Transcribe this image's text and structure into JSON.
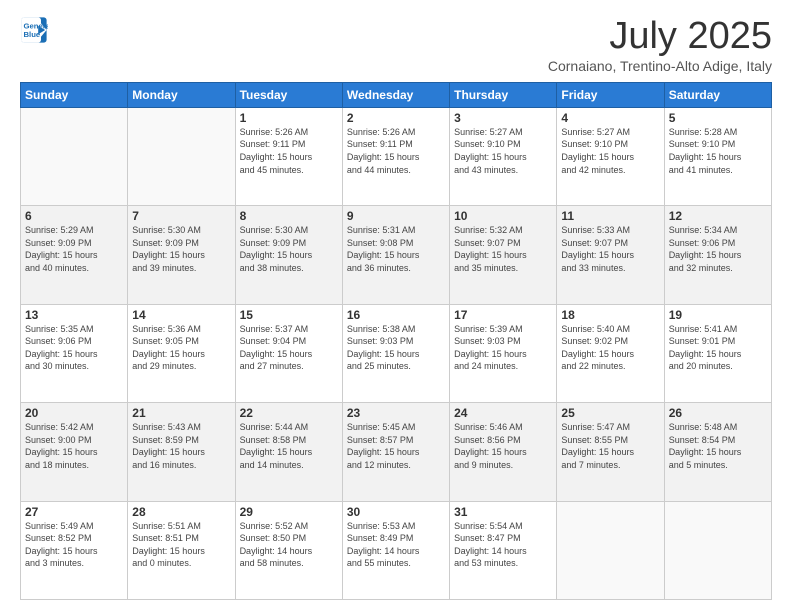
{
  "logo": {
    "line1": "General",
    "line2": "Blue"
  },
  "title": "July 2025",
  "subtitle": "Cornaiano, Trentino-Alto Adige, Italy",
  "weekdays": [
    "Sunday",
    "Monday",
    "Tuesday",
    "Wednesday",
    "Thursday",
    "Friday",
    "Saturday"
  ],
  "weeks": [
    [
      {
        "day": "",
        "info": ""
      },
      {
        "day": "",
        "info": ""
      },
      {
        "day": "1",
        "info": "Sunrise: 5:26 AM\nSunset: 9:11 PM\nDaylight: 15 hours\nand 45 minutes."
      },
      {
        "day": "2",
        "info": "Sunrise: 5:26 AM\nSunset: 9:11 PM\nDaylight: 15 hours\nand 44 minutes."
      },
      {
        "day": "3",
        "info": "Sunrise: 5:27 AM\nSunset: 9:10 PM\nDaylight: 15 hours\nand 43 minutes."
      },
      {
        "day": "4",
        "info": "Sunrise: 5:27 AM\nSunset: 9:10 PM\nDaylight: 15 hours\nand 42 minutes."
      },
      {
        "day": "5",
        "info": "Sunrise: 5:28 AM\nSunset: 9:10 PM\nDaylight: 15 hours\nand 41 minutes."
      }
    ],
    [
      {
        "day": "6",
        "info": "Sunrise: 5:29 AM\nSunset: 9:09 PM\nDaylight: 15 hours\nand 40 minutes."
      },
      {
        "day": "7",
        "info": "Sunrise: 5:30 AM\nSunset: 9:09 PM\nDaylight: 15 hours\nand 39 minutes."
      },
      {
        "day": "8",
        "info": "Sunrise: 5:30 AM\nSunset: 9:09 PM\nDaylight: 15 hours\nand 38 minutes."
      },
      {
        "day": "9",
        "info": "Sunrise: 5:31 AM\nSunset: 9:08 PM\nDaylight: 15 hours\nand 36 minutes."
      },
      {
        "day": "10",
        "info": "Sunrise: 5:32 AM\nSunset: 9:07 PM\nDaylight: 15 hours\nand 35 minutes."
      },
      {
        "day": "11",
        "info": "Sunrise: 5:33 AM\nSunset: 9:07 PM\nDaylight: 15 hours\nand 33 minutes."
      },
      {
        "day": "12",
        "info": "Sunrise: 5:34 AM\nSunset: 9:06 PM\nDaylight: 15 hours\nand 32 minutes."
      }
    ],
    [
      {
        "day": "13",
        "info": "Sunrise: 5:35 AM\nSunset: 9:06 PM\nDaylight: 15 hours\nand 30 minutes."
      },
      {
        "day": "14",
        "info": "Sunrise: 5:36 AM\nSunset: 9:05 PM\nDaylight: 15 hours\nand 29 minutes."
      },
      {
        "day": "15",
        "info": "Sunrise: 5:37 AM\nSunset: 9:04 PM\nDaylight: 15 hours\nand 27 minutes."
      },
      {
        "day": "16",
        "info": "Sunrise: 5:38 AM\nSunset: 9:03 PM\nDaylight: 15 hours\nand 25 minutes."
      },
      {
        "day": "17",
        "info": "Sunrise: 5:39 AM\nSunset: 9:03 PM\nDaylight: 15 hours\nand 24 minutes."
      },
      {
        "day": "18",
        "info": "Sunrise: 5:40 AM\nSunset: 9:02 PM\nDaylight: 15 hours\nand 22 minutes."
      },
      {
        "day": "19",
        "info": "Sunrise: 5:41 AM\nSunset: 9:01 PM\nDaylight: 15 hours\nand 20 minutes."
      }
    ],
    [
      {
        "day": "20",
        "info": "Sunrise: 5:42 AM\nSunset: 9:00 PM\nDaylight: 15 hours\nand 18 minutes."
      },
      {
        "day": "21",
        "info": "Sunrise: 5:43 AM\nSunset: 8:59 PM\nDaylight: 15 hours\nand 16 minutes."
      },
      {
        "day": "22",
        "info": "Sunrise: 5:44 AM\nSunset: 8:58 PM\nDaylight: 15 hours\nand 14 minutes."
      },
      {
        "day": "23",
        "info": "Sunrise: 5:45 AM\nSunset: 8:57 PM\nDaylight: 15 hours\nand 12 minutes."
      },
      {
        "day": "24",
        "info": "Sunrise: 5:46 AM\nSunset: 8:56 PM\nDaylight: 15 hours\nand 9 minutes."
      },
      {
        "day": "25",
        "info": "Sunrise: 5:47 AM\nSunset: 8:55 PM\nDaylight: 15 hours\nand 7 minutes."
      },
      {
        "day": "26",
        "info": "Sunrise: 5:48 AM\nSunset: 8:54 PM\nDaylight: 15 hours\nand 5 minutes."
      }
    ],
    [
      {
        "day": "27",
        "info": "Sunrise: 5:49 AM\nSunset: 8:52 PM\nDaylight: 15 hours\nand 3 minutes."
      },
      {
        "day": "28",
        "info": "Sunrise: 5:51 AM\nSunset: 8:51 PM\nDaylight: 15 hours\nand 0 minutes."
      },
      {
        "day": "29",
        "info": "Sunrise: 5:52 AM\nSunset: 8:50 PM\nDaylight: 14 hours\nand 58 minutes."
      },
      {
        "day": "30",
        "info": "Sunrise: 5:53 AM\nSunset: 8:49 PM\nDaylight: 14 hours\nand 55 minutes."
      },
      {
        "day": "31",
        "info": "Sunrise: 5:54 AM\nSunset: 8:47 PM\nDaylight: 14 hours\nand 53 minutes."
      },
      {
        "day": "",
        "info": ""
      },
      {
        "day": "",
        "info": ""
      }
    ]
  ]
}
